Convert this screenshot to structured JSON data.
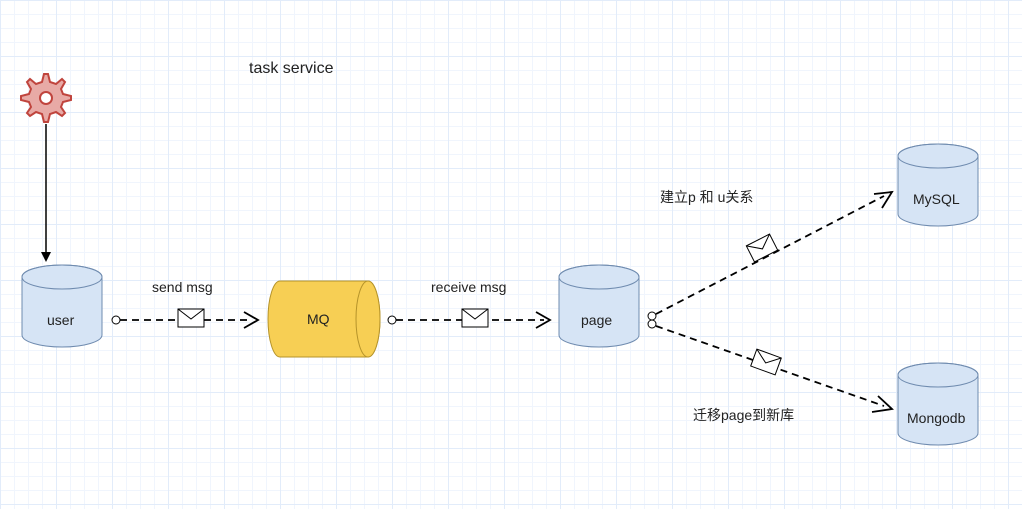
{
  "title": "task service",
  "nodes": {
    "user": {
      "label": "user"
    },
    "mq": {
      "label": "MQ"
    },
    "page": {
      "label": "page"
    },
    "mysql": {
      "label": "MySQL"
    },
    "mongodb": {
      "label": "Mongodb"
    }
  },
  "edges": {
    "user_to_mq": {
      "label": "send msg"
    },
    "mq_to_page": {
      "label": "receive msg"
    },
    "page_to_mysql": {
      "label": "建立p 和 u关系"
    },
    "page_to_mongodb": {
      "label": "迁移page到新库"
    }
  },
  "chart_data": {
    "type": "diagram",
    "title": "task service",
    "nodes": [
      {
        "id": "gear",
        "type": "process-icon"
      },
      {
        "id": "user",
        "type": "datastore",
        "label": "user"
      },
      {
        "id": "mq",
        "type": "queue",
        "label": "MQ"
      },
      {
        "id": "page",
        "type": "datastore",
        "label": "page"
      },
      {
        "id": "mysql",
        "type": "datastore",
        "label": "MySQL"
      },
      {
        "id": "mongodb",
        "type": "datastore",
        "label": "Mongodb"
      }
    ],
    "edges": [
      {
        "from": "gear",
        "to": "user",
        "style": "solid"
      },
      {
        "from": "user",
        "to": "mq",
        "style": "dashed-message",
        "label": "send msg"
      },
      {
        "from": "mq",
        "to": "page",
        "style": "dashed-message",
        "label": "receive msg"
      },
      {
        "from": "page",
        "to": "mysql",
        "style": "dashed-message",
        "label": "建立p 和 u关系"
      },
      {
        "from": "page",
        "to": "mongodb",
        "style": "dashed-message",
        "label": "迁移page到新库"
      }
    ]
  }
}
